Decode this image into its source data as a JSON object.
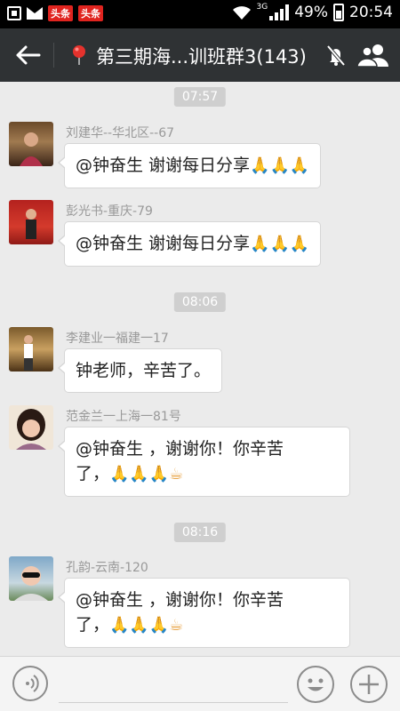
{
  "status_bar": {
    "notif_app": "头条",
    "network": "3G",
    "battery": "49%",
    "time": "20:54"
  },
  "header": {
    "title": "第三期海...训班群3(143)"
  },
  "chat": {
    "timestamps": [
      "07:57",
      "08:06",
      "08:16"
    ],
    "messages": [
      {
        "sender": "刘建华--华北区--67",
        "text": "@钟奋生 谢谢每日分享",
        "emoji": "🙏🙏🙏"
      },
      {
        "sender": "彭光书-重庆-79",
        "text": "@钟奋生 谢谢每日分享",
        "emoji": "🙏🙏🙏"
      },
      {
        "sender": "李建业一福建一17",
        "text": "钟老师，辛苦了。",
        "emoji": ""
      },
      {
        "sender": "范金兰一上海一81号",
        "text_line1": "@钟奋生 ，谢谢你！你辛苦",
        "text_line2": "了，",
        "emoji": "🙏🙏🙏☕"
      },
      {
        "sender": "孔韵-云南-120",
        "text_line1": "@钟奋生 ，谢谢你！你辛苦",
        "text_line2": "了，",
        "emoji": "🙏🙏🙏☕"
      }
    ]
  },
  "input": {
    "value": "",
    "placeholder": ""
  },
  "icons": {
    "back": "back-arrow-icon",
    "pin": "location-pin-icon",
    "mute": "mute-bell-icon",
    "members": "group-members-icon",
    "voice": "voice-icon",
    "emoji": "emoji-icon",
    "plus": "plus-icon"
  },
  "colors": {
    "title_bar": "#2f3234",
    "chat_bg": "#ebebeb",
    "pin": "#e5322d",
    "toutiao": "#e0241f"
  }
}
